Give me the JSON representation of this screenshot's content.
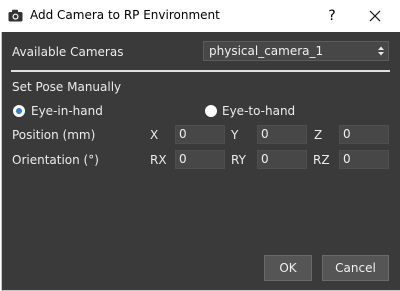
{
  "window": {
    "title": "Add Camera to RP Environment",
    "help_label": "?"
  },
  "cameras": {
    "label": "Available Cameras",
    "selected": "physical_camera_1"
  },
  "pose": {
    "section_label": "Set Pose Manually",
    "mode_options": [
      {
        "label": "Eye-in-hand",
        "checked": true
      },
      {
        "label": "Eye-to-hand",
        "checked": false
      }
    ],
    "position": {
      "label": "Position (mm)",
      "fields": [
        {
          "axis": "X",
          "value": "0"
        },
        {
          "axis": "Y",
          "value": "0"
        },
        {
          "axis": "Z",
          "value": "0"
        }
      ]
    },
    "orientation": {
      "label": "Orientation (°)",
      "fields": [
        {
          "axis": "RX",
          "value": "0"
        },
        {
          "axis": "RY",
          "value": "0"
        },
        {
          "axis": "RZ",
          "value": "0"
        }
      ]
    }
  },
  "buttons": {
    "ok": "OK",
    "cancel": "Cancel"
  },
  "colors": {
    "panel_bg": "#3a3a3a",
    "input_bg": "#474747",
    "radio_accent": "#2f7fd6"
  }
}
